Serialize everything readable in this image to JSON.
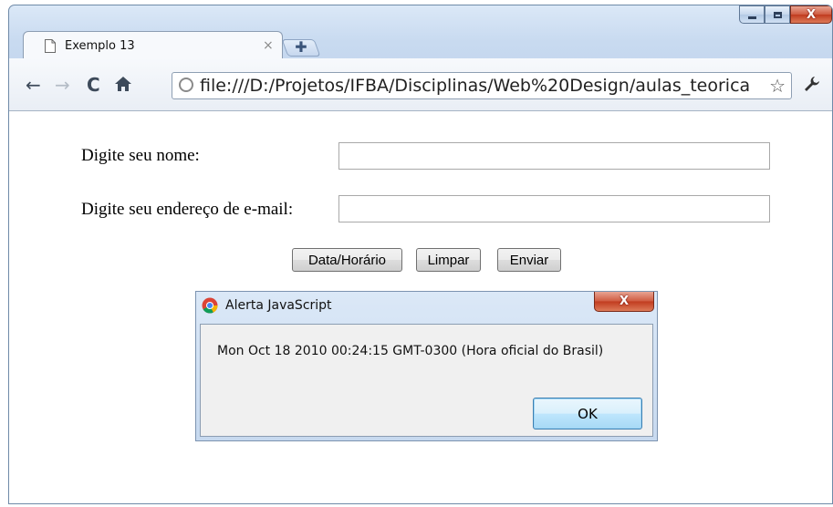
{
  "window": {
    "caption_buttons": {
      "minimize_icon": "minimize-icon",
      "maximize_icon": "maximize-icon",
      "close_label": "X"
    }
  },
  "tab": {
    "title": "Exemplo 13",
    "close_glyph": "×",
    "icon": "page-icon"
  },
  "new_tab": {
    "glyph": "✚"
  },
  "toolbar": {
    "back_glyph": "←",
    "forward_glyph": "→",
    "reload_glyph": "C",
    "home_glyph": "🏠",
    "url": "file:///D:/Projetos/IFBA/Disciplinas/Web%20Design/aulas_teorica",
    "star_glyph": "☆",
    "wrench_glyph": "🔧"
  },
  "form": {
    "name_label": "Digite seu nome:",
    "name_value": "",
    "email_label": "Digite seu endereço de e-mail:",
    "email_value": "",
    "buttons": {
      "datetime": "Data/Horário",
      "clear": "Limpar",
      "submit": "Enviar"
    }
  },
  "alert": {
    "title": "Alerta JavaScript",
    "close_label": "X",
    "message": "Mon Oct 18 2010 00:24:15 GMT-0300 (Hora oficial do Brasil)",
    "ok_label": "OK"
  },
  "colors": {
    "chrome_frame": "#c8daf0",
    "close_red": "#c13b1f",
    "ok_focus": "#3c7fb1"
  }
}
